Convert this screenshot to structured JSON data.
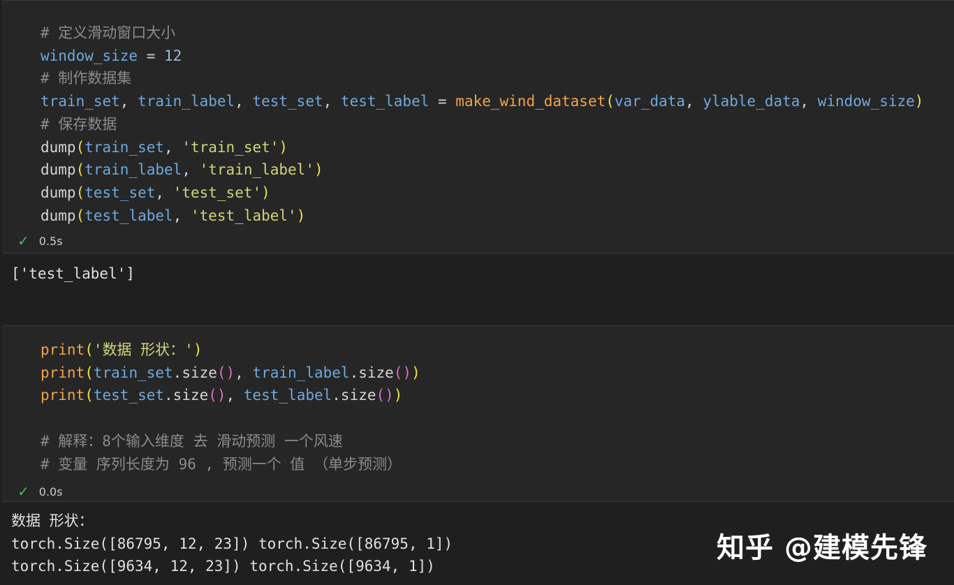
{
  "cell1": {
    "lines": [
      [
        {
          "t": "# 定义滑动窗口大小",
          "c": "c"
        }
      ],
      [
        {
          "t": "window_size",
          "c": "v"
        },
        {
          "t": " = ",
          "c": "p"
        },
        {
          "t": "12",
          "c": "n"
        }
      ],
      [
        {
          "t": "# 制作数据集",
          "c": "c"
        }
      ],
      [
        {
          "t": "train_set",
          "c": "v"
        },
        {
          "t": ", ",
          "c": "p"
        },
        {
          "t": "train_label",
          "c": "v"
        },
        {
          "t": ", ",
          "c": "p"
        },
        {
          "t": "test_set",
          "c": "v"
        },
        {
          "t": ", ",
          "c": "p"
        },
        {
          "t": "test_label",
          "c": "v"
        },
        {
          "t": " = ",
          "c": "p"
        },
        {
          "t": "make_wind_dataset",
          "c": "f"
        },
        {
          "t": "(",
          "c": "y"
        },
        {
          "t": "var_data",
          "c": "v"
        },
        {
          "t": ", ",
          "c": "p"
        },
        {
          "t": "ylable_data",
          "c": "v"
        },
        {
          "t": ", ",
          "c": "p"
        },
        {
          "t": "window_size",
          "c": "v"
        },
        {
          "t": ")",
          "c": "y"
        }
      ],
      [
        {
          "t": "# 保存数据",
          "c": "c"
        }
      ],
      [
        {
          "t": "dump",
          "c": "m"
        },
        {
          "t": "(",
          "c": "y"
        },
        {
          "t": "train_set",
          "c": "v"
        },
        {
          "t": ", ",
          "c": "p"
        },
        {
          "t": "'train_set'",
          "c": "s"
        },
        {
          "t": ")",
          "c": "y"
        }
      ],
      [
        {
          "t": "dump",
          "c": "m"
        },
        {
          "t": "(",
          "c": "y"
        },
        {
          "t": "train_label",
          "c": "v"
        },
        {
          "t": ", ",
          "c": "p"
        },
        {
          "t": "'train_label'",
          "c": "s"
        },
        {
          "t": ")",
          "c": "y"
        }
      ],
      [
        {
          "t": "dump",
          "c": "m"
        },
        {
          "t": "(",
          "c": "y"
        },
        {
          "t": "test_set",
          "c": "v"
        },
        {
          "t": ", ",
          "c": "p"
        },
        {
          "t": "'test_set'",
          "c": "s"
        },
        {
          "t": ")",
          "c": "y"
        }
      ],
      [
        {
          "t": "dump",
          "c": "m"
        },
        {
          "t": "(",
          "c": "y"
        },
        {
          "t": "test_label",
          "c": "v"
        },
        {
          "t": ", ",
          "c": "p"
        },
        {
          "t": "'test_label'",
          "c": "s"
        },
        {
          "t": ")",
          "c": "y"
        }
      ]
    ],
    "exec_time": "0.5s",
    "output": [
      "['test_label']"
    ]
  },
  "cell2": {
    "lines": [
      [
        {
          "t": "print",
          "c": "f"
        },
        {
          "t": "(",
          "c": "y"
        },
        {
          "t": "'数据 形状：'",
          "c": "s"
        },
        {
          "t": ")",
          "c": "y"
        }
      ],
      [
        {
          "t": "print",
          "c": "f"
        },
        {
          "t": "(",
          "c": "y"
        },
        {
          "t": "train_set",
          "c": "v"
        },
        {
          "t": ".size",
          "c": "m"
        },
        {
          "t": "()",
          "c": "pk"
        },
        {
          "t": ", ",
          "c": "p"
        },
        {
          "t": "train_label",
          "c": "v"
        },
        {
          "t": ".size",
          "c": "m"
        },
        {
          "t": "()",
          "c": "pk"
        },
        {
          "t": ")",
          "c": "y"
        }
      ],
      [
        {
          "t": "print",
          "c": "f"
        },
        {
          "t": "(",
          "c": "y"
        },
        {
          "t": "test_set",
          "c": "v"
        },
        {
          "t": ".size",
          "c": "m"
        },
        {
          "t": "()",
          "c": "pk"
        },
        {
          "t": ", ",
          "c": "p"
        },
        {
          "t": "test_label",
          "c": "v"
        },
        {
          "t": ".size",
          "c": "m"
        },
        {
          "t": "()",
          "c": "pk"
        },
        {
          "t": ")",
          "c": "y"
        }
      ],
      [],
      [
        {
          "t": "# 解释：8个输入维度 去 滑动预测 一个风速",
          "c": "c"
        }
      ],
      [
        {
          "t": "# 变量 序列长度为 96 , 预测一个 值 （单步预测）",
          "c": "c"
        }
      ]
    ],
    "exec_time": "0.0s",
    "output": [
      "数据 形状：",
      "torch.Size([86795, 12, 23]) torch.Size([86795, 1])",
      "torch.Size([9634, 12, 23]) torch.Size([9634, 1])"
    ]
  },
  "watermark": "知乎 @建模先锋",
  "colors": {
    "comment": "#8b8b8b",
    "variable": "#6fa8dc",
    "function": "#f0a34a",
    "string": "#cfd57a",
    "bracket": "#ebe34a",
    "check": "#4fb36b"
  }
}
